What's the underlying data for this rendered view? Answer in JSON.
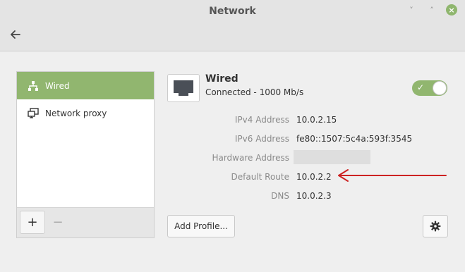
{
  "window": {
    "title": "Network",
    "minimize_symbol": "˅",
    "maximize_symbol": "˄",
    "close_symbol": "×"
  },
  "sidebar": {
    "items": [
      {
        "label": "Wired",
        "icon": "network-wired-icon",
        "active": true
      },
      {
        "label": "Network proxy",
        "icon": "network-proxy-icon",
        "active": false
      }
    ],
    "add_symbol": "+",
    "remove_symbol": "−"
  },
  "device": {
    "name": "Wired",
    "status": "Connected - 1000 Mb/s",
    "enabled": true,
    "toggle_check": "✓"
  },
  "details": [
    {
      "label": "IPv4 Address",
      "value": "10.0.2.15"
    },
    {
      "label": "IPv6 Address",
      "value": "fe80::1507:5c4a:593f:3545"
    },
    {
      "label": "Hardware Address",
      "value": ""
    },
    {
      "label": "Default Route",
      "value": "10.0.2.2"
    },
    {
      "label": "DNS",
      "value": "10.0.2.3"
    }
  ],
  "buttons": {
    "add_profile": "Add Profile..."
  },
  "colors": {
    "accent": "#91b66f",
    "annotation_arrow": "#cc2222"
  }
}
